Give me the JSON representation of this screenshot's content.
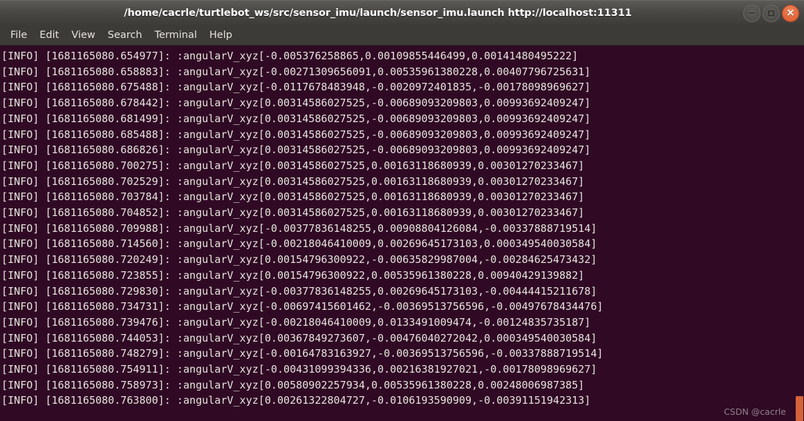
{
  "window": {
    "title": "/home/cacrle/turtlebot_ws/src/sensor_imu/launch/sensor_imu.launch http://localhost:11311",
    "controls": {
      "minimize_label": "−",
      "maximize_label": "□",
      "close_label": "×"
    }
  },
  "menubar": {
    "items": [
      {
        "label": "File"
      },
      {
        "label": "Edit"
      },
      {
        "label": "View"
      },
      {
        "label": "Search"
      },
      {
        "label": "Terminal"
      },
      {
        "label": "Help"
      }
    ]
  },
  "terminal": {
    "background_color": "#300a24",
    "foreground_color": "#e6e3de",
    "lines": [
      "[INFO] [1681165080.654977]: :angularV_xyz[-0.005376258865,0.00109855446499,0.00141480495222]",
      "[INFO] [1681165080.658883]: :angularV_xyz[-0.00271309656091,0.00535961380228,0.00407796725631]",
      "[INFO] [1681165080.675488]: :angularV_xyz[-0.0117678483948,-0.0020972401835,-0.00178098969627]",
      "[INFO] [1681165080.678442]: :angularV_xyz[0.00314586027525,-0.00689093209803,0.00993692409247]",
      "[INFO] [1681165080.681499]: :angularV_xyz[0.00314586027525,-0.00689093209803,0.00993692409247]",
      "[INFO] [1681165080.685488]: :angularV_xyz[0.00314586027525,-0.00689093209803,0.00993692409247]",
      "[INFO] [1681165080.686826]: :angularV_xyz[0.00314586027525,-0.00689093209803,0.00993692409247]",
      "[INFO] [1681165080.700275]: :angularV_xyz[0.00314586027525,0.00163118680939,0.00301270233467]",
      "[INFO] [1681165080.702529]: :angularV_xyz[0.00314586027525,0.00163118680939,0.00301270233467]",
      "[INFO] [1681165080.703784]: :angularV_xyz[0.00314586027525,0.00163118680939,0.00301270233467]",
      "[INFO] [1681165080.704852]: :angularV_xyz[0.00314586027525,0.00163118680939,0.00301270233467]",
      "[INFO] [1681165080.709988]: :angularV_xyz[-0.00377836148255,0.00908804126084,-0.00337888719514]",
      "[INFO] [1681165080.714560]: :angularV_xyz[-0.00218046410009,0.00269645173103,0.000349540030584]",
      "[INFO] [1681165080.720249]: :angularV_xyz[0.00154796300922,-0.00635829987004,-0.00284625473432]",
      "[INFO] [1681165080.723855]: :angularV_xyz[0.00154796300922,0.00535961380228,0.00940429139882]",
      "[INFO] [1681165080.729830]: :angularV_xyz[-0.00377836148255,0.00269645173103,-0.00444415211678]",
      "[INFO] [1681165080.734731]: :angularV_xyz[-0.00697415601462,-0.00369513756596,-0.00497678434476]",
      "[INFO] [1681165080.739476]: :angularV_xyz[-0.00218046410009,0.0133491009474,-0.00124835735187]",
      "[INFO] [1681165080.744053]: :angularV_xyz[0.00367849273607,-0.00476040272042,0.000349540030584]",
      "[INFO] [1681165080.748279]: :angularV_xyz[-0.00164783163927,-0.00369513756596,-0.00337888719514]",
      "[INFO] [1681165080.754911]: :angularV_xyz[-0.00431099394336,0.00216381927021,-0.00178098969627]",
      "[INFO] [1681165080.758973]: :angularV_xyz[0.00580902257934,0.00535961380228,0.00248006987385]",
      "[INFO] [1681165080.763800]: :angularV_xyz[0.00261322804727,-0.0106193590909,-0.00391151942313]"
    ]
  },
  "watermark": {
    "text": "CSDN @cacrle"
  },
  "scrollbar": {
    "accent_color": "#d4623a"
  }
}
